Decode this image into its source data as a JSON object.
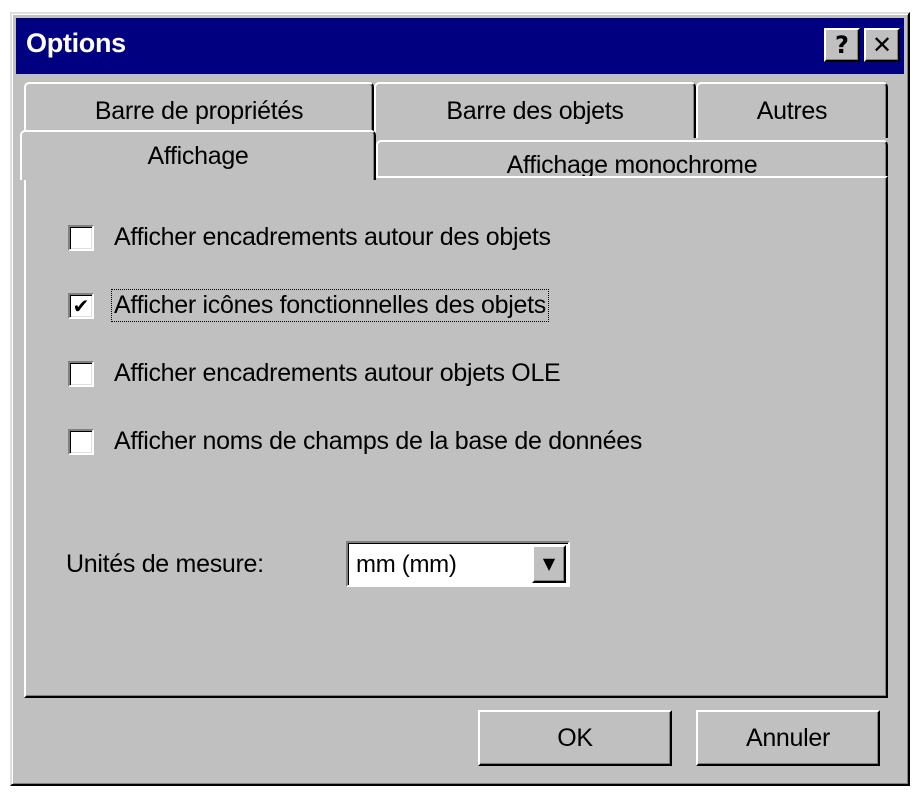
{
  "window": {
    "title": "Options",
    "help_button": "?",
    "close_button": "✕"
  },
  "tabs": {
    "back_row": [
      "Barre de propriétés",
      "Barre des objets",
      "Autres"
    ],
    "front_row": [
      "Affichage",
      "Affichage monochrome"
    ],
    "active": "Affichage"
  },
  "options": [
    {
      "label": "Afficher encadrements autour des objets",
      "checked": false
    },
    {
      "label": "Afficher icônes fonctionnelles des objets",
      "checked": true,
      "focused": true
    },
    {
      "label": "Afficher encadrements autour objets OLE",
      "checked": false
    },
    {
      "label": "Afficher noms de champs de la base de données",
      "checked": false
    }
  ],
  "units": {
    "label": "Unités de mesure:",
    "value": "mm (mm)"
  },
  "buttons": {
    "ok": "OK",
    "cancel": "Annuler"
  },
  "colors": {
    "title_bar": "#000080",
    "face": "#c0c0c0"
  },
  "icons": {
    "check": "✔",
    "dropdown": "▼"
  }
}
